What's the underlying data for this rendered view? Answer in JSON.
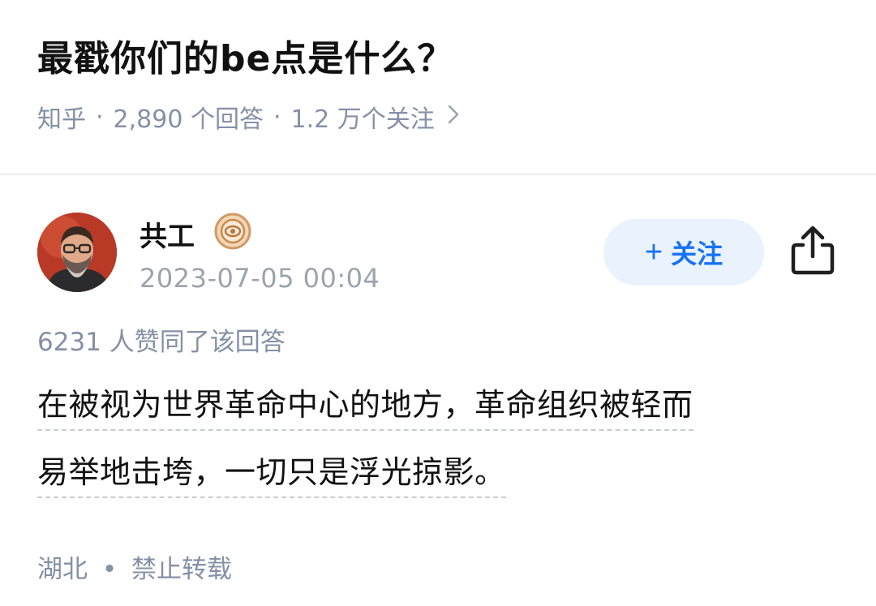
{
  "question": {
    "title": "最戳你们的be点是什么？",
    "source": "知乎",
    "answer_count": "2,890 个回答",
    "follower_count": "1.2 万个关注",
    "separator": "·"
  },
  "author": {
    "name": "共工",
    "time": "2023-07-05 00:04",
    "follow_label": "关注",
    "badge_icon": "verified-badge-icon",
    "avatar_icon": "avatar"
  },
  "vote_text": "6231 人赞同了该回答",
  "answer": {
    "line1": "在被视为世界革命中心的地方，革命组织被轻而",
    "line2": "易举地击垮，一切只是浮光掠影。"
  },
  "footer": {
    "location": "湖北",
    "dot": "•",
    "copyright": "禁止转载"
  },
  "colors": {
    "accent": "#1772f6",
    "muted": "#8590a6",
    "follow_bg": "#eaf2fd"
  }
}
